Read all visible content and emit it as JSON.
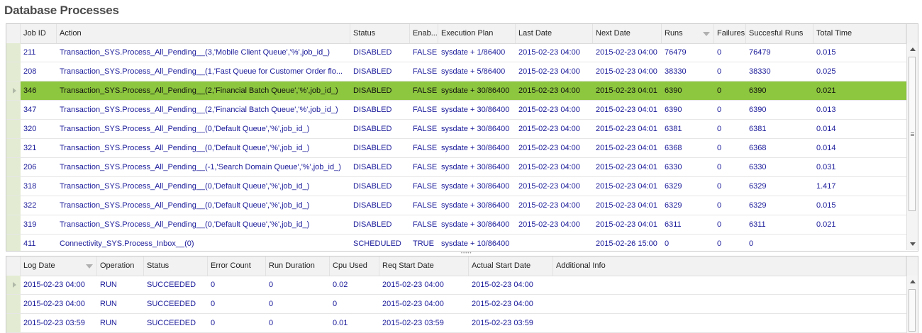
{
  "page_title": "Database Processes",
  "processes": {
    "columns": [
      "Job ID",
      "Action",
      "Status",
      "Enab...",
      "Execution Plan",
      "Last Date",
      "Next Date",
      "Runs",
      "Failures",
      "Succesful Runs",
      "Total Time"
    ],
    "sorted_column": "Runs",
    "selected_row_index": 2,
    "rows": [
      [
        "211",
        "Transaction_SYS.Process_All_Pending__(3,'Mobile Client Queue','%',job_id_)",
        "DISABLED",
        "FALSE",
        "sysdate + 1/86400",
        "2015-02-23 04:00",
        "2015-02-23 04:00",
        "76479",
        "0",
        "76479",
        "0.015"
      ],
      [
        "208",
        "Transaction_SYS.Process_All_Pending__(1,'Fast Queue for Customer Order flo...",
        "DISABLED",
        "FALSE",
        "sysdate + 5/86400",
        "2015-02-23 04:00",
        "2015-02-23 04:00",
        "38330",
        "0",
        "38330",
        "0.025"
      ],
      [
        "346",
        "Transaction_SYS.Process_All_Pending__(2,'Financial Batch Queue','%',job_id_)",
        "DISABLED",
        "FALSE",
        "sysdate + 30/86400",
        "2015-02-23 04:00",
        "2015-02-23 04:01",
        "6390",
        "0",
        "6390",
        "0.021"
      ],
      [
        "347",
        "Transaction_SYS.Process_All_Pending__(2,'Financial Batch Queue','%',job_id_)",
        "DISABLED",
        "FALSE",
        "sysdate + 30/86400",
        "2015-02-23 04:00",
        "2015-02-23 04:01",
        "6390",
        "0",
        "6390",
        "0.013"
      ],
      [
        "320",
        "Transaction_SYS.Process_All_Pending__(0,'Default Queue','%',job_id_)",
        "DISABLED",
        "FALSE",
        "sysdate + 30/86400",
        "2015-02-23 04:00",
        "2015-02-23 04:01",
        "6381",
        "0",
        "6381",
        "0.014"
      ],
      [
        "321",
        "Transaction_SYS.Process_All_Pending__(0,'Default Queue','%',job_id_)",
        "DISABLED",
        "FALSE",
        "sysdate + 30/86400",
        "2015-02-23 04:00",
        "2015-02-23 04:01",
        "6368",
        "0",
        "6368",
        "0.014"
      ],
      [
        "206",
        "Transaction_SYS.Process_All_Pending__(-1,'Search Domain Queue','%',job_id_)",
        "DISABLED",
        "FALSE",
        "sysdate + 30/86400",
        "2015-02-23 04:00",
        "2015-02-23 04:01",
        "6330",
        "0",
        "6330",
        "0.031"
      ],
      [
        "318",
        "Transaction_SYS.Process_All_Pending__(0,'Default Queue','%',job_id_)",
        "DISABLED",
        "FALSE",
        "sysdate + 30/86400",
        "2015-02-23 04:00",
        "2015-02-23 04:01",
        "6329",
        "0",
        "6329",
        "1.417"
      ],
      [
        "322",
        "Transaction_SYS.Process_All_Pending__(0,'Default Queue','%',job_id_)",
        "DISABLED",
        "FALSE",
        "sysdate + 30/86400",
        "2015-02-23 04:00",
        "2015-02-23 04:01",
        "6329",
        "0",
        "6329",
        "0.015"
      ],
      [
        "319",
        "Transaction_SYS.Process_All_Pending__(0,'Default Queue','%',job_id_)",
        "DISABLED",
        "FALSE",
        "sysdate + 30/86400",
        "2015-02-23 04:00",
        "2015-02-23 04:01",
        "6311",
        "0",
        "6311",
        "0.021"
      ],
      [
        "411",
        "Connectivity_SYS.Process_Inbox__(0)",
        "SCHEDULED",
        "TRUE",
        "sysdate + 10/86400",
        "",
        "2015-02-26 15:00",
        "0",
        "0",
        "0",
        ""
      ]
    ]
  },
  "log": {
    "columns": [
      "Log Date",
      "Operation",
      "Status",
      "Error Count",
      "Run Duration",
      "Cpu Used",
      "Req Start Date",
      "Actual Start Date",
      "Additional Info"
    ],
    "sorted_column": "Log Date",
    "rows": [
      [
        "2015-02-23 04:00",
        "RUN",
        "SUCCEEDED",
        "0",
        "0",
        "0.02",
        "2015-02-23 04:00",
        "2015-02-23 04:00",
        ""
      ],
      [
        "2015-02-23 04:00",
        "RUN",
        "SUCCEEDED",
        "0",
        "0",
        "0",
        "2015-02-23 04:00",
        "2015-02-23 04:00",
        ""
      ],
      [
        "2015-02-23 03:59",
        "RUN",
        "SUCCEEDED",
        "0",
        "0",
        "0.01",
        "2015-02-23 03:59",
        "2015-02-23 03:59",
        ""
      ]
    ]
  },
  "colors": {
    "selected_row": "#8dc63f",
    "link_text": "#1a1a9a",
    "row_indicator": "#e3ecd2"
  }
}
